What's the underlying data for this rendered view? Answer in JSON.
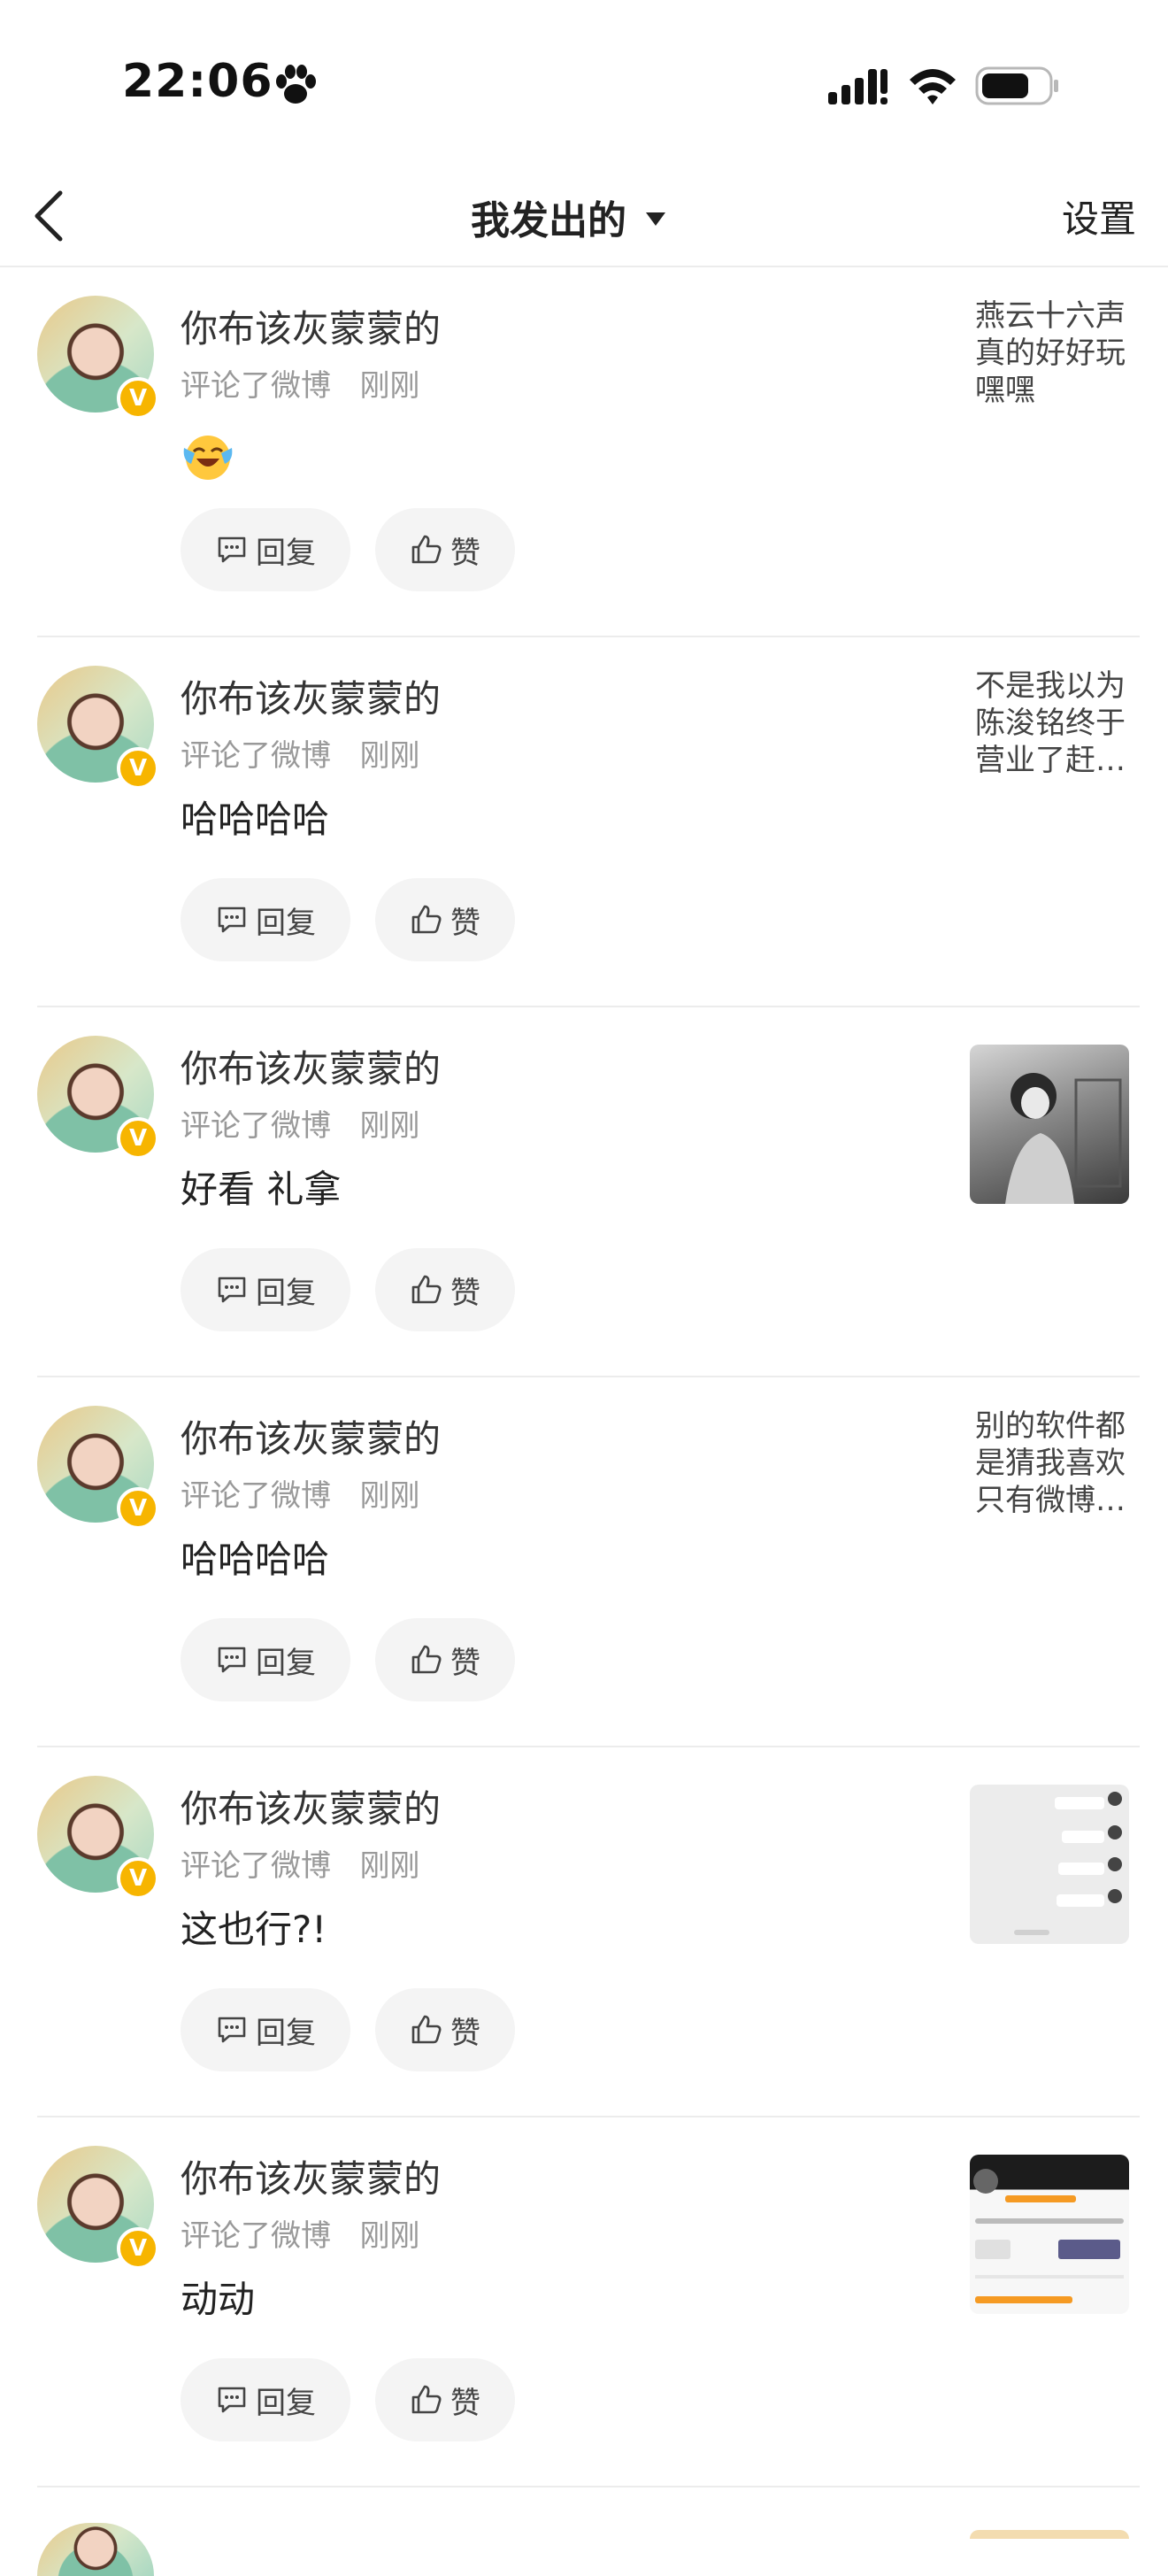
{
  "status_bar": {
    "time": "22:06"
  },
  "nav": {
    "title": "我发出的",
    "settings": "设置"
  },
  "colors": {
    "badge": "#f7b500",
    "button_bg": "#f4f4f4",
    "meta": "#999999"
  },
  "comments": [
    {
      "username": "你布该灰蒙蒙的",
      "action": "评论了微博",
      "time": "刚刚",
      "content": "",
      "content_emoji": "laughing-crying-emoji",
      "reply_label": "回复",
      "like_label": "赞",
      "post_preview": "燕云十六声真的好好玩嘿嘿"
    },
    {
      "username": "你布该灰蒙蒙的",
      "action": "评论了微博",
      "time": "刚刚",
      "content": "哈哈哈哈",
      "reply_label": "回复",
      "like_label": "赞",
      "post_preview": "不是我以为陈浚铭终于营业了赶…"
    },
    {
      "username": "你布该灰蒙蒙的",
      "action": "评论了微博",
      "time": "刚刚",
      "content": "好看 礼拿",
      "reply_label": "回复",
      "like_label": "赞",
      "post_thumbnail": "black-and-white-photo"
    },
    {
      "username": "你布该灰蒙蒙的",
      "action": "评论了微博",
      "time": "刚刚",
      "content": "哈哈哈哈",
      "reply_label": "回复",
      "like_label": "赞",
      "post_preview": "别的软件都是猜我喜欢只有微博…"
    },
    {
      "username": "你布该灰蒙蒙的",
      "action": "评论了微博",
      "time": "刚刚",
      "content": "这也行?!",
      "reply_label": "回复",
      "like_label": "赞",
      "post_thumbnail": "chat-screenshot"
    },
    {
      "username": "你布该灰蒙蒙的",
      "action": "评论了微博",
      "time": "刚刚",
      "content": "动动",
      "reply_label": "回复",
      "like_label": "赞",
      "post_thumbnail": "profile-screenshot"
    }
  ]
}
